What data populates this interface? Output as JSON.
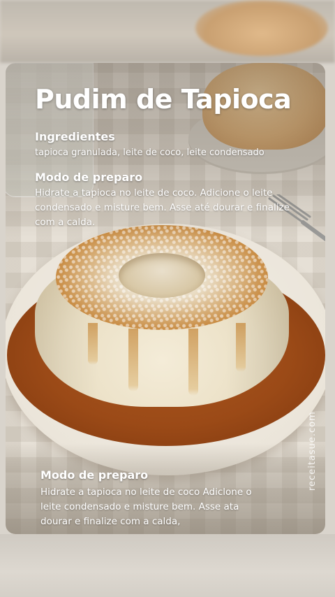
{
  "card": {
    "title": "Pudim de Tapioca",
    "ingredients_heading": "Ingredientes",
    "ingredients_text": "tapioca granulada, leite de coco, leite condensado",
    "method_heading": "Modo de preparo",
    "method_text": "Hidrate a tapioca no leite de coco. Adicione o leite condensado e misture bem. Asse até dourar e finalize com a calda.",
    "method_heading_2": "Modo de preparo",
    "method_text_2": "Hidrate a tapioca no leite de coco  Adiclone o leite condensado e misture bem. Asse ata dourar e finalize com a calda,",
    "watermark": "receitasue.com"
  }
}
